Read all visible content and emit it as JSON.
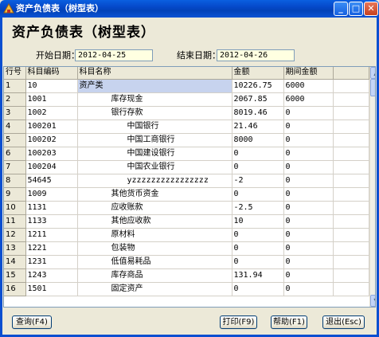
{
  "window": {
    "title": "资产负债表（树型表）"
  },
  "page_title": "资产负债表（树型表）",
  "filters": {
    "start_label": "开始日期：",
    "start_value": "2012-04-25",
    "end_label": "结束日期：",
    "end_value": "2012-04-26"
  },
  "grid": {
    "columns": [
      "行号",
      "科目编码",
      "科目名称",
      "金额",
      "期间金额"
    ],
    "rows": [
      {
        "num": "1",
        "code": "10",
        "name": "资产类",
        "amount": "10226.75",
        "period": "6000",
        "indent": 0
      },
      {
        "num": "2",
        "code": "1001",
        "name": "库存现金",
        "amount": "2067.85",
        "period": "6000",
        "indent": 1
      },
      {
        "num": "3",
        "code": "1002",
        "name": "银行存款",
        "amount": "8019.46",
        "period": "0",
        "indent": 1
      },
      {
        "num": "4",
        "code": "100201",
        "name": "中国银行",
        "amount": "21.46",
        "period": "0",
        "indent": 2
      },
      {
        "num": "5",
        "code": "100202",
        "name": "中国工商银行",
        "amount": "8000",
        "period": "0",
        "indent": 2
      },
      {
        "num": "6",
        "code": "100203",
        "name": "中国建设银行",
        "amount": "0",
        "period": "0",
        "indent": 2
      },
      {
        "num": "7",
        "code": "100204",
        "name": "中国农业银行",
        "amount": "0",
        "period": "0",
        "indent": 2
      },
      {
        "num": "8",
        "code": "54645",
        "name": "yzzzzzzzzzzzzzzzz",
        "amount": "-2",
        "period": "0",
        "indent": 2
      },
      {
        "num": "9",
        "code": "1009",
        "name": "其他货币资金",
        "amount": "0",
        "period": "0",
        "indent": 1
      },
      {
        "num": "10",
        "code": "1131",
        "name": "应收账款",
        "amount": "-2.5",
        "period": "0",
        "indent": 1
      },
      {
        "num": "11",
        "code": "1133",
        "name": "其他应收款",
        "amount": "10",
        "period": "0",
        "indent": 1
      },
      {
        "num": "12",
        "code": "1211",
        "name": "原材料",
        "amount": "0",
        "period": "0",
        "indent": 1
      },
      {
        "num": "13",
        "code": "1221",
        "name": "包装物",
        "amount": "0",
        "period": "0",
        "indent": 1
      },
      {
        "num": "14",
        "code": "1231",
        "name": "低值易耗品",
        "amount": "0",
        "period": "0",
        "indent": 1
      },
      {
        "num": "15",
        "code": "1243",
        "name": "库存商品",
        "amount": "131.94",
        "period": "0",
        "indent": 1
      },
      {
        "num": "16",
        "code": "1501",
        "name": "固定资产",
        "amount": "0",
        "period": "0",
        "indent": 1
      }
    ]
  },
  "buttons": {
    "query": "查询(F4)",
    "print": "打印(F9)",
    "help": "帮助(F1)",
    "exit": "退出(Esc)"
  }
}
